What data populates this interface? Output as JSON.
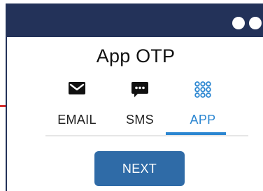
{
  "screen": {
    "title": "App OTP"
  },
  "tabs": [
    {
      "label": "EMAIL",
      "icon": "envelope-icon",
      "selected": false
    },
    {
      "label": "SMS",
      "icon": "chat-bubble-icon",
      "selected": false
    },
    {
      "label": "APP",
      "icon": "grid-dots-icon",
      "selected": true
    }
  ],
  "actions": {
    "next_label": "NEXT"
  },
  "colors": {
    "titlebar": "#233259",
    "accent": "#2b86d1",
    "button": "#2f6ba7",
    "red_connector": "#d62f2f"
  }
}
